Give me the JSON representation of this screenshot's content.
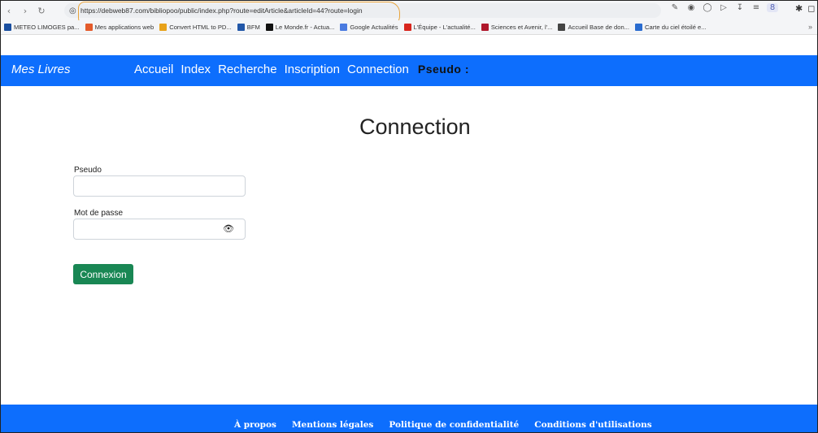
{
  "browser": {
    "url": "https://debweb87.com/bibliopoo/public/index.php?route=editArticle&articleId=44?route=login",
    "bookmarks": [
      {
        "label": "METEO LIMOGES pa...",
        "color": "#1a4fa0"
      },
      {
        "label": "Mes applications web",
        "color": "#e45b2b"
      },
      {
        "label": "Convert HTML to PD...",
        "color": "#e8a21a"
      },
      {
        "label": "BFM",
        "color": "#2257a8"
      },
      {
        "label": "Le Monde.fr - Actua...",
        "color": "#111111"
      },
      {
        "label": "Google Actualités",
        "color": "#4a7be0"
      },
      {
        "label": "L'Équipe - L'actualité...",
        "color": "#d8261d"
      },
      {
        "label": "Sciences et Avenir, l'...",
        "color": "#b0182c"
      },
      {
        "label": "Accueil Base de don...",
        "color": "#444444"
      },
      {
        "label": "Carte du ciel étoilé e...",
        "color": "#2a6ccf"
      }
    ],
    "bookmarks_more": "»"
  },
  "navbar": {
    "brand": "Mes Livres",
    "links": [
      "Accueil",
      "Index",
      "Recherche",
      "Inscription",
      "Connection"
    ],
    "pseudo": "Pseudo :"
  },
  "main": {
    "title": "Connection",
    "pseudo_label": "Pseudo",
    "pseudo_value": "",
    "password_label": "Mot de passe",
    "password_value": "",
    "submit_label": "Connexion"
  },
  "footer": {
    "links": [
      "À propos",
      "Mentions légales",
      "Politique de confidentialité",
      "Conditions d'utilisations"
    ]
  },
  "colors": {
    "primary": "#0d6efd",
    "button": "#198754",
    "url_highlight": "#e8a33a"
  }
}
